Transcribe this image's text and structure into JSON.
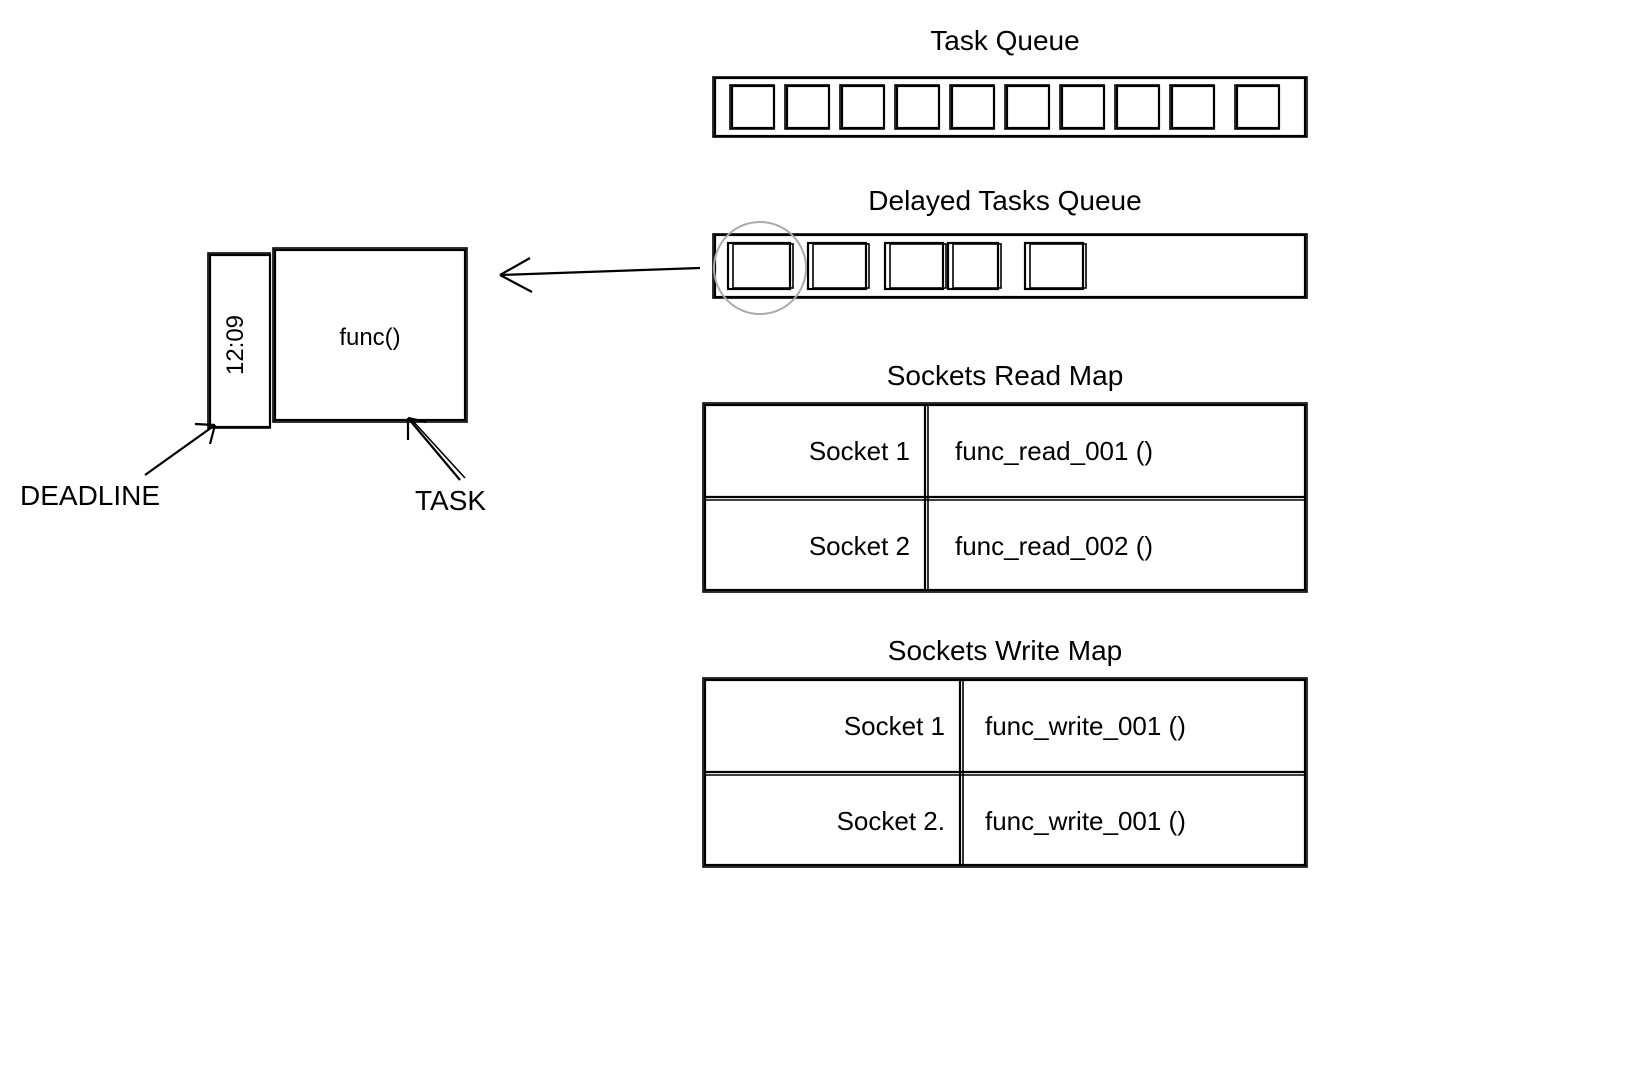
{
  "task_queue": {
    "title": "Task Queue",
    "slots": 10
  },
  "delayed_tasks_queue": {
    "title": "Delayed Tasks Queue",
    "slots": 5
  },
  "detail_task": {
    "deadline_value": "12:09",
    "body": "func()",
    "deadline_label": "DEADLINE",
    "task_label": "TASK"
  },
  "sockets_read": {
    "title": "Sockets Read Map",
    "rows": [
      {
        "key": "Socket 1",
        "value": "func_read_001 ()"
      },
      {
        "key": "Socket 2",
        "value": "func_read_002 ()"
      }
    ]
  },
  "sockets_write": {
    "title": "Sockets Write Map",
    "rows": [
      {
        "key": "Socket 1",
        "value": "func_write_001 ()"
      },
      {
        "key": "Socket 2.",
        "value": "func_write_001 ()"
      }
    ]
  }
}
